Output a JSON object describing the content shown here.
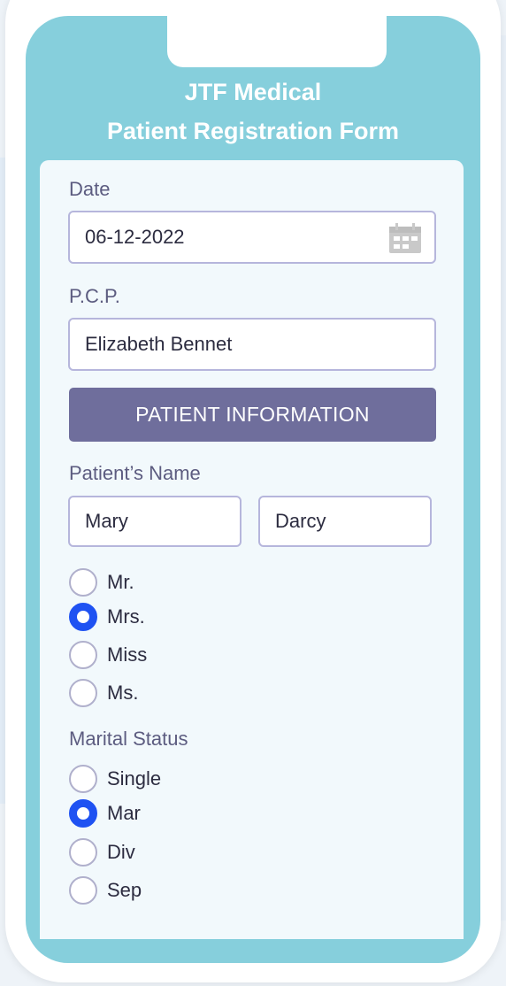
{
  "form": {
    "title_line1": "JTF Medical",
    "title_line2": "Patient Registration Form"
  },
  "date": {
    "label": "Date",
    "value": "06-12-2022"
  },
  "pcp": {
    "label": "P.C.P.",
    "value": "Elizabeth Bennet"
  },
  "section_button": "PATIENT INFORMATION",
  "patient_name": {
    "label": "Patient’s Name",
    "first": "Mary",
    "last": "Darcy"
  },
  "title_options": [
    {
      "label": "Mr.",
      "selected": false
    },
    {
      "label": "Mrs.",
      "selected": true
    },
    {
      "label": "Miss",
      "selected": false
    },
    {
      "label": "Ms.",
      "selected": false
    }
  ],
  "marital_status": {
    "label": "Marital Status",
    "options": [
      {
        "label": "Single",
        "selected": false
      },
      {
        "label": "Mar",
        "selected": true
      },
      {
        "label": "Div",
        "selected": false
      },
      {
        "label": "Sep",
        "selected": false
      }
    ]
  },
  "colors": {
    "header_bg": "#86cfdc",
    "section_button_bg": "#6f6e9c",
    "radio_selected": "#1f52f2"
  }
}
